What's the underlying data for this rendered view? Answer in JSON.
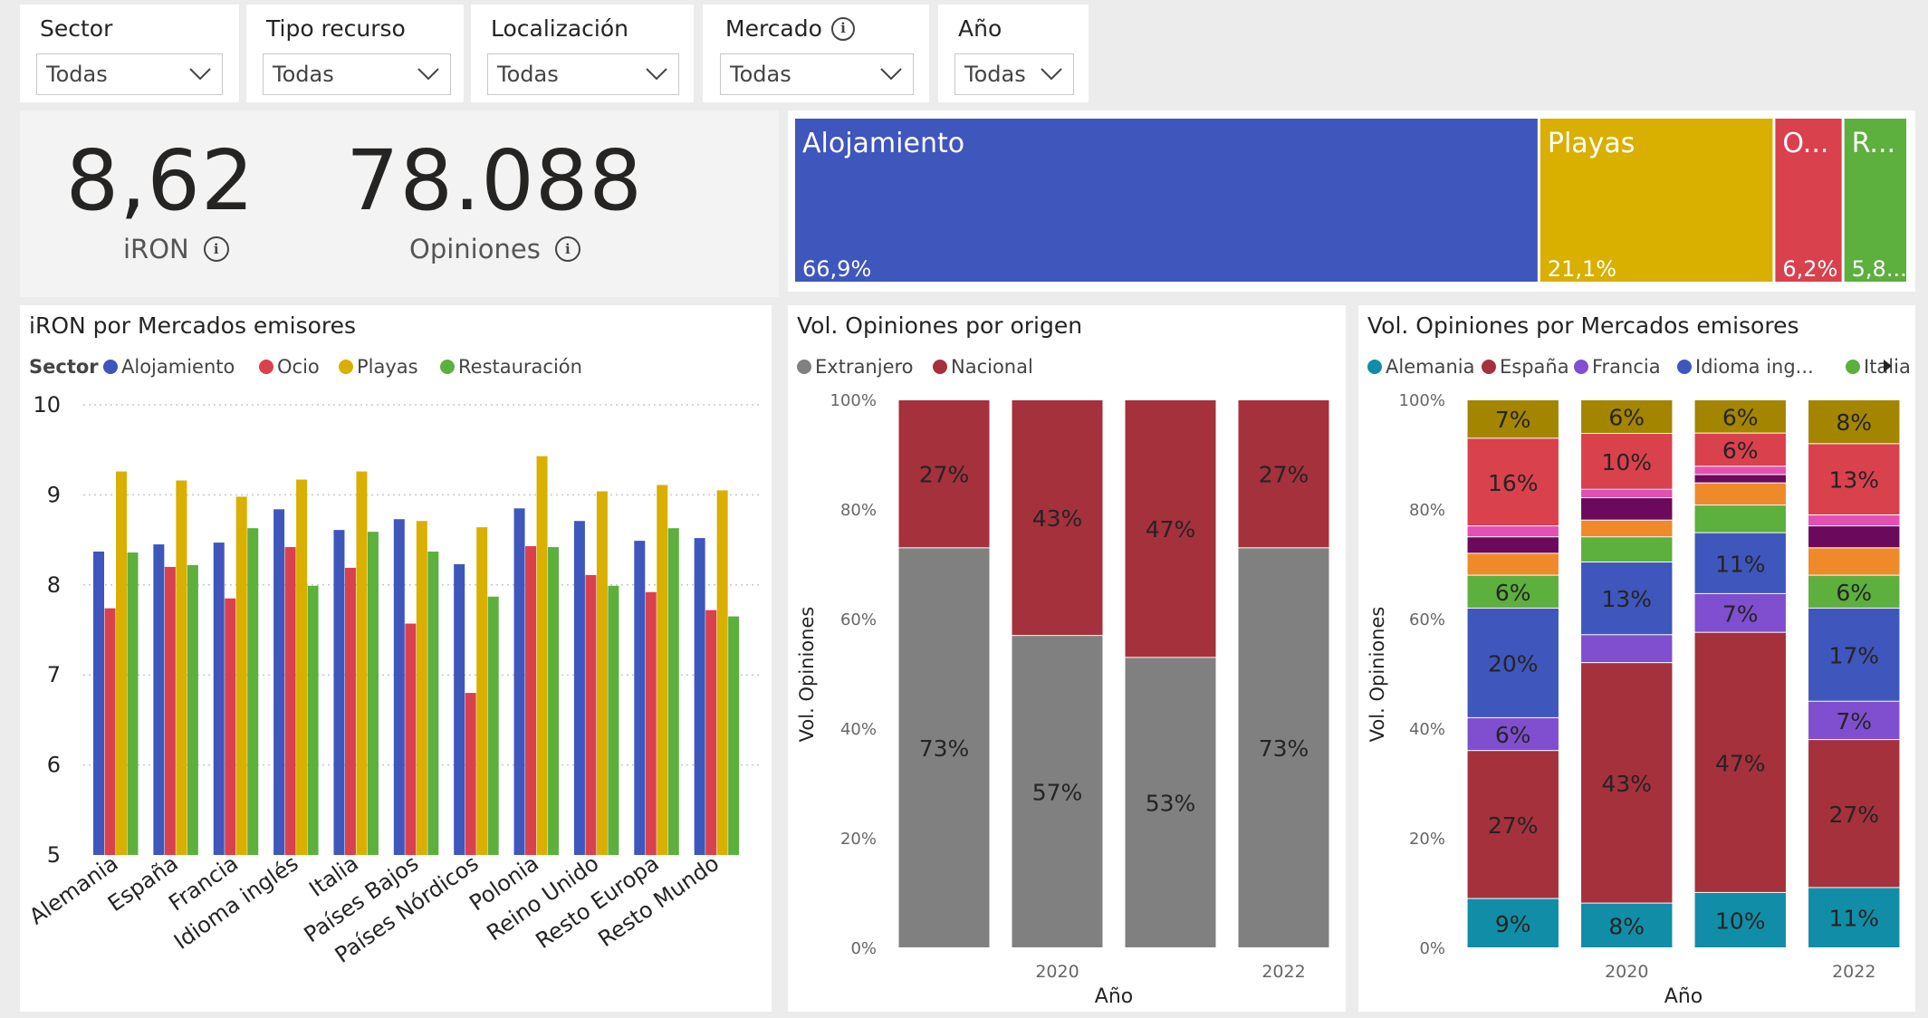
{
  "slicers": [
    {
      "title": "Sector",
      "value": "Todas",
      "info": false
    },
    {
      "title": "Tipo recurso",
      "value": "Todas",
      "info": false
    },
    {
      "title": "Localización",
      "value": "Todas",
      "info": false
    },
    {
      "title": "Mercado",
      "value": "Todas",
      "info": true
    },
    {
      "title": "Año",
      "value": "Todas",
      "info": false
    }
  ],
  "kpis": {
    "iron": {
      "value": "8,62",
      "label": "iRON"
    },
    "opiniones": {
      "value": "78.088",
      "label": "Opiniones"
    }
  },
  "treemap": {
    "items": [
      {
        "label": "Alojamiento",
        "pct_label": "66,9%",
        "share": 0.669,
        "color": "#3F56BC"
      },
      {
        "label": "Playas",
        "pct_label": "21,1%",
        "share": 0.211,
        "color": "#D9AF00"
      },
      {
        "label": "O...",
        "pct_label": "6,2%",
        "share": 0.062,
        "color": "#D9414D"
      },
      {
        "label": "R...",
        "pct_label": "5,8...",
        "share": 0.058,
        "color": "#5DAF3E"
      }
    ]
  },
  "chart_data": [
    {
      "type": "bar",
      "title": "iRON por Mercados emisores",
      "legend_title": "Sector",
      "legend_position": "top-left",
      "grid": true,
      "ylim": [
        5,
        10
      ],
      "yticks": [
        "5",
        "6",
        "7",
        "8",
        "9",
        "10"
      ],
      "categories": [
        "Alemania",
        "España",
        "Francia",
        "Idioma inglés",
        "Italia",
        "Países Bajos",
        "Países Nórdicos",
        "Polonia",
        "Reino Unido",
        "Resto Europa",
        "Resto Mundo"
      ],
      "series": [
        {
          "name": "Alojamiento",
          "color": "#3F56BC",
          "values": [
            8.37,
            8.45,
            8.47,
            8.84,
            8.61,
            8.73,
            8.23,
            8.85,
            8.71,
            8.49,
            8.52
          ]
        },
        {
          "name": "Ocio",
          "color": "#D9414D",
          "values": [
            7.74,
            8.2,
            7.85,
            8.42,
            8.19,
            7.57,
            6.8,
            8.43,
            8.11,
            7.92,
            7.72
          ]
        },
        {
          "name": "Playas",
          "color": "#D9AF00",
          "values": [
            9.26,
            9.16,
            8.98,
            9.17,
            9.26,
            8.71,
            8.64,
            9.43,
            9.04,
            9.11,
            9.05
          ]
        },
        {
          "name": "Restauración",
          "color": "#5DAF3E",
          "values": [
            8.36,
            8.22,
            8.63,
            7.99,
            8.59,
            8.37,
            7.87,
            8.42,
            7.99,
            8.63,
            7.65
          ]
        }
      ]
    },
    {
      "type": "bar",
      "stacked": "percent",
      "title": "Vol. Opiniones por origen",
      "xlabel": "Año",
      "ylabel": "Vol. Opiniones",
      "legend_position": "top-left",
      "yticks": [
        "0%",
        "20%",
        "40%",
        "60%",
        "80%",
        "100%"
      ],
      "x_tick_labels": [
        "",
        "2020",
        "",
        "2022"
      ],
      "series": [
        {
          "name": "Extranjero",
          "color": "#808080",
          "values": [
            73,
            57,
            53,
            73
          ],
          "labels": [
            "73%",
            "57%",
            "53%",
            "73%"
          ]
        },
        {
          "name": "Nacional",
          "color": "#A4313C",
          "values": [
            27,
            43,
            47,
            27
          ],
          "labels": [
            "27%",
            "43%",
            "47%",
            "27%"
          ]
        }
      ]
    },
    {
      "type": "bar",
      "stacked": "percent",
      "title": "Vol. Opiniones por Mercados emisores",
      "xlabel": "Año",
      "ylabel": "Vol. Opiniones",
      "legend_position": "top-left",
      "yticks": [
        "0%",
        "20%",
        "40%",
        "60%",
        "80%",
        "100%"
      ],
      "x_tick_labels": [
        "",
        "2020",
        "",
        "2022"
      ],
      "series": [
        {
          "name": "Alemania",
          "color": "#118DA8",
          "values": [
            9,
            8,
            10,
            11
          ],
          "labels": [
            "9%",
            "8%",
            "10%",
            "11%"
          ]
        },
        {
          "name": "España",
          "color": "#A4313C",
          "values": [
            27,
            43,
            47,
            27
          ],
          "labels": [
            "27%",
            "43%",
            "47%",
            "27%"
          ]
        },
        {
          "name": "Francia",
          "color": "#7F4FCF",
          "values": [
            6,
            5,
            7,
            7
          ],
          "labels": [
            "6%",
            "",
            "7%",
            "7%"
          ]
        },
        {
          "name": "Idioma ing...",
          "color": "#3F56BC",
          "values": [
            20,
            13,
            11,
            17
          ],
          "labels": [
            "20%",
            "13%",
            "11%",
            "17%"
          ]
        },
        {
          "name": "Italia",
          "color": "#5DAF3E",
          "values": [
            6,
            4.5,
            5,
            6
          ],
          "labels": [
            "6%",
            "",
            "",
            "6%"
          ]
        },
        {
          "name": "",
          "color": "#EF8A2B",
          "values": [
            4,
            3,
            4,
            5
          ],
          "labels": [
            "",
            "",
            "",
            ""
          ]
        },
        {
          "name": "",
          "color": "#6B0A5C",
          "values": [
            3,
            4,
            1.5,
            4
          ],
          "labels": [
            "",
            "",
            "",
            ""
          ]
        },
        {
          "name": "",
          "color": "#E34FB2",
          "values": [
            2,
            1.5,
            1.5,
            2
          ],
          "labels": [
            "",
            "",
            "",
            ""
          ]
        },
        {
          "name": "",
          "color": "#D9414D",
          "values": [
            16,
            10,
            6,
            13
          ],
          "labels": [
            "16%",
            "10%",
            "6%",
            "13%"
          ]
        },
        {
          "name": "",
          "color": "#A38500",
          "values": [
            7,
            6,
            6,
            8
          ],
          "labels": [
            "7%",
            "6%",
            "6%",
            "8%"
          ]
        }
      ]
    }
  ]
}
